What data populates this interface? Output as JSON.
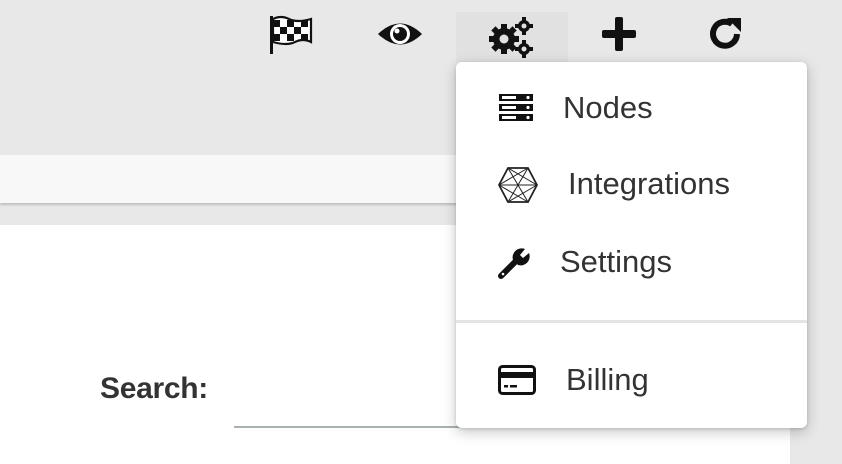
{
  "toolbar": {
    "icons": [
      {
        "name": "flag-icon"
      },
      {
        "name": "eye-icon"
      },
      {
        "name": "gears-icon",
        "active": true
      },
      {
        "name": "plus-icon"
      },
      {
        "name": "refresh-icon"
      }
    ]
  },
  "menu": {
    "items": [
      {
        "label": "Nodes",
        "icon": "server-icon"
      },
      {
        "label": "Integrations",
        "icon": "hexagon-icon"
      },
      {
        "label": "Settings",
        "icon": "wrench-icon"
      },
      {
        "label": "Billing",
        "icon": "credit-card-icon"
      }
    ]
  },
  "search": {
    "label": "Search:",
    "value": "",
    "placeholder": ""
  },
  "colors": {
    "background": "#e8e8e8",
    "active_tab": "#e1e1e1",
    "panel": "#ffffff",
    "input_underline": "#a9b3ad",
    "icon": "#111111"
  }
}
